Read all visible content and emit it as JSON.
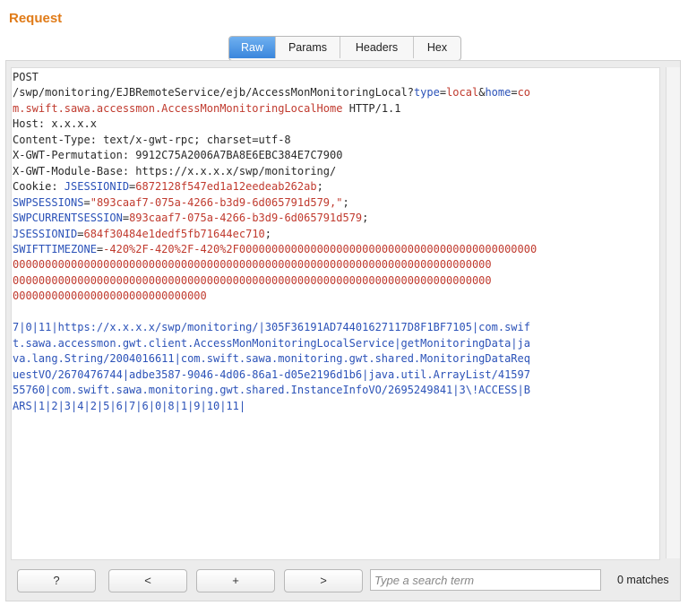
{
  "title": "Request",
  "tabs": [
    "Raw",
    "Params",
    "Headers",
    "Hex"
  ],
  "active_tab": "Raw",
  "request": {
    "method": "POST",
    "path": "/swp/monitoring/EJBRemoteService/ejb/AccessMonMonitoringLocal?",
    "q1_key": "type",
    "q1_val": "local",
    "q2_key": "home",
    "q2_val_a": "co",
    "q2_val_b": "m.swift.sawa.accessmon.AccessMonMonitoringLocalHome",
    "protocol": " HTTP/1.1",
    "headers": [
      "Host: x.x.x.x",
      "Content-Type: text/x-gwt-rpc; charset=utf-8",
      "X-GWT-Permutation: 9912C75A2006A7BA8E6EBC384E7C7900",
      "X-GWT-Module-Base: https://x.x.x.x/swp/monitoring/"
    ],
    "cookie_label": "Cookie: ",
    "cookies": [
      {
        "name": "JSESSIONID",
        "value": "6872128f547ed1a12eedeab262ab",
        "sep": ";"
      },
      {
        "name": "SWPSESSIONS",
        "value": "\"893caaf7-075a-4266-b3d9-6d065791d579,\"",
        "sep": ";"
      },
      {
        "name": "SWPCURRENTSESSION",
        "value": "893caaf7-075a-4266-b3d9-6d065791d579",
        "sep": ";"
      },
      {
        "name": "JSESSIONID",
        "value": "684f30484e1dedf5fb71644ec710",
        "sep": ";"
      },
      {
        "name": "SWIFTTIMEZONE",
        "value": "-420%2F-420%2F-420%2F0000000000000000000000000000000000000000000000",
        "sep": ""
      }
    ],
    "tz_cont_1": "00000000000000000000000000000000000000000000000000000000000000000000000000",
    "tz_cont_2": "00000000000000000000000000000000000000000000000000000000000000000000000000",
    "tz_cont_3": "000000000000000000000000000000",
    "body_lines": [
      "7|0|11|https://x.x.x.x/swp/monitoring/|305F36191AD74401627117D8F1BF7105|com.swif",
      "t.sawa.accessmon.gwt.client.AccessMonMonitoringLocalService|getMonitoringData|ja",
      "va.lang.String/2004016611|com.swift.sawa.monitoring.gwt.shared.MonitoringDataReq",
      "uestVO/2670476744|adbe3587-9046-4d06-86a1-d05e2196d1b6|java.util.ArrayList/41597",
      "55760|com.swift.sawa.monitoring.gwt.shared.InstanceInfoVO/2695249841|3\\!ACCESS|B",
      "ARS|1|2|3|4|2|5|6|7|6|0|8|1|9|10|11|"
    ]
  },
  "toolbar": {
    "help_label": "?",
    "prev_label": "<",
    "add_label": "+",
    "next_label": ">",
    "search_placeholder": "Type a search term",
    "matches_text": "0 matches"
  }
}
